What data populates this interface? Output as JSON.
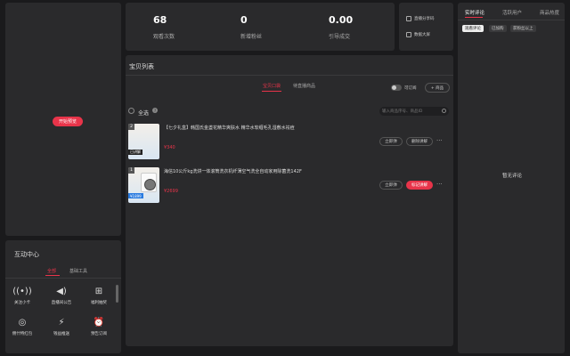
{
  "start_button": "开始预览",
  "interaction": {
    "title": "互动中心",
    "tabs": [
      "全部",
      "基础工具"
    ],
    "tools": [
      {
        "label": "关注小卡",
        "icon": "signal-icon"
      },
      {
        "label": "直播间公告",
        "icon": "megaphone-icon"
      },
      {
        "label": "福利抽奖",
        "icon": "gift-icon"
      },
      {
        "label": "佣什特红包",
        "icon": "coin-icon"
      },
      {
        "label": "钱益推送",
        "icon": "lightning-icon"
      },
      {
        "label": "预告订阅",
        "icon": "clock-icon"
      }
    ]
  },
  "stats": [
    {
      "value": "68",
      "label": "观看次数"
    },
    {
      "value": "0",
      "label": "新增粉丝"
    },
    {
      "value": "0.00",
      "label": "引导成交"
    }
  ],
  "quick": [
    "直播分享码",
    "数据大屏"
  ],
  "products": {
    "title": "宝贝列表",
    "tabs": [
      "宝贝口袋",
      "待直播商品"
    ],
    "toggle_label": "可订阅",
    "add_label": "+ 商品",
    "select_all": "全选",
    "search_placeholder": "输入商品序号、商品ID",
    "items": [
      {
        "index": "2",
        "name": "【七夕礼盒】韩国氏金盏花精华爽肤水 精华水软缠毛孔湿敷水祛痘",
        "price": "¥340",
        "tag": "已讲解",
        "btn1": "立即弹",
        "btn2": "删除讲解",
        "btn2_red": false
      },
      {
        "index": "1",
        "name": "海信10公斤kg洗烘一体滚筒洗衣机纤薄空气洗全自动家用除菌洗142F",
        "price": "¥2699",
        "tag": "¥1899",
        "btn1": "立即弹",
        "btn2": "标记讲解",
        "btn2_red": true
      }
    ]
  },
  "comments": {
    "tabs": [
      "实时评论",
      "活跃用户",
      "商品热度"
    ],
    "filters": [
      "观看评论",
      "已加购",
      "获粉丝以上"
    ],
    "empty": "暂无评论"
  },
  "colors": {
    "accent": "#e8344a",
    "panel": "#2a2a2c",
    "background": "#1a1a1c"
  }
}
